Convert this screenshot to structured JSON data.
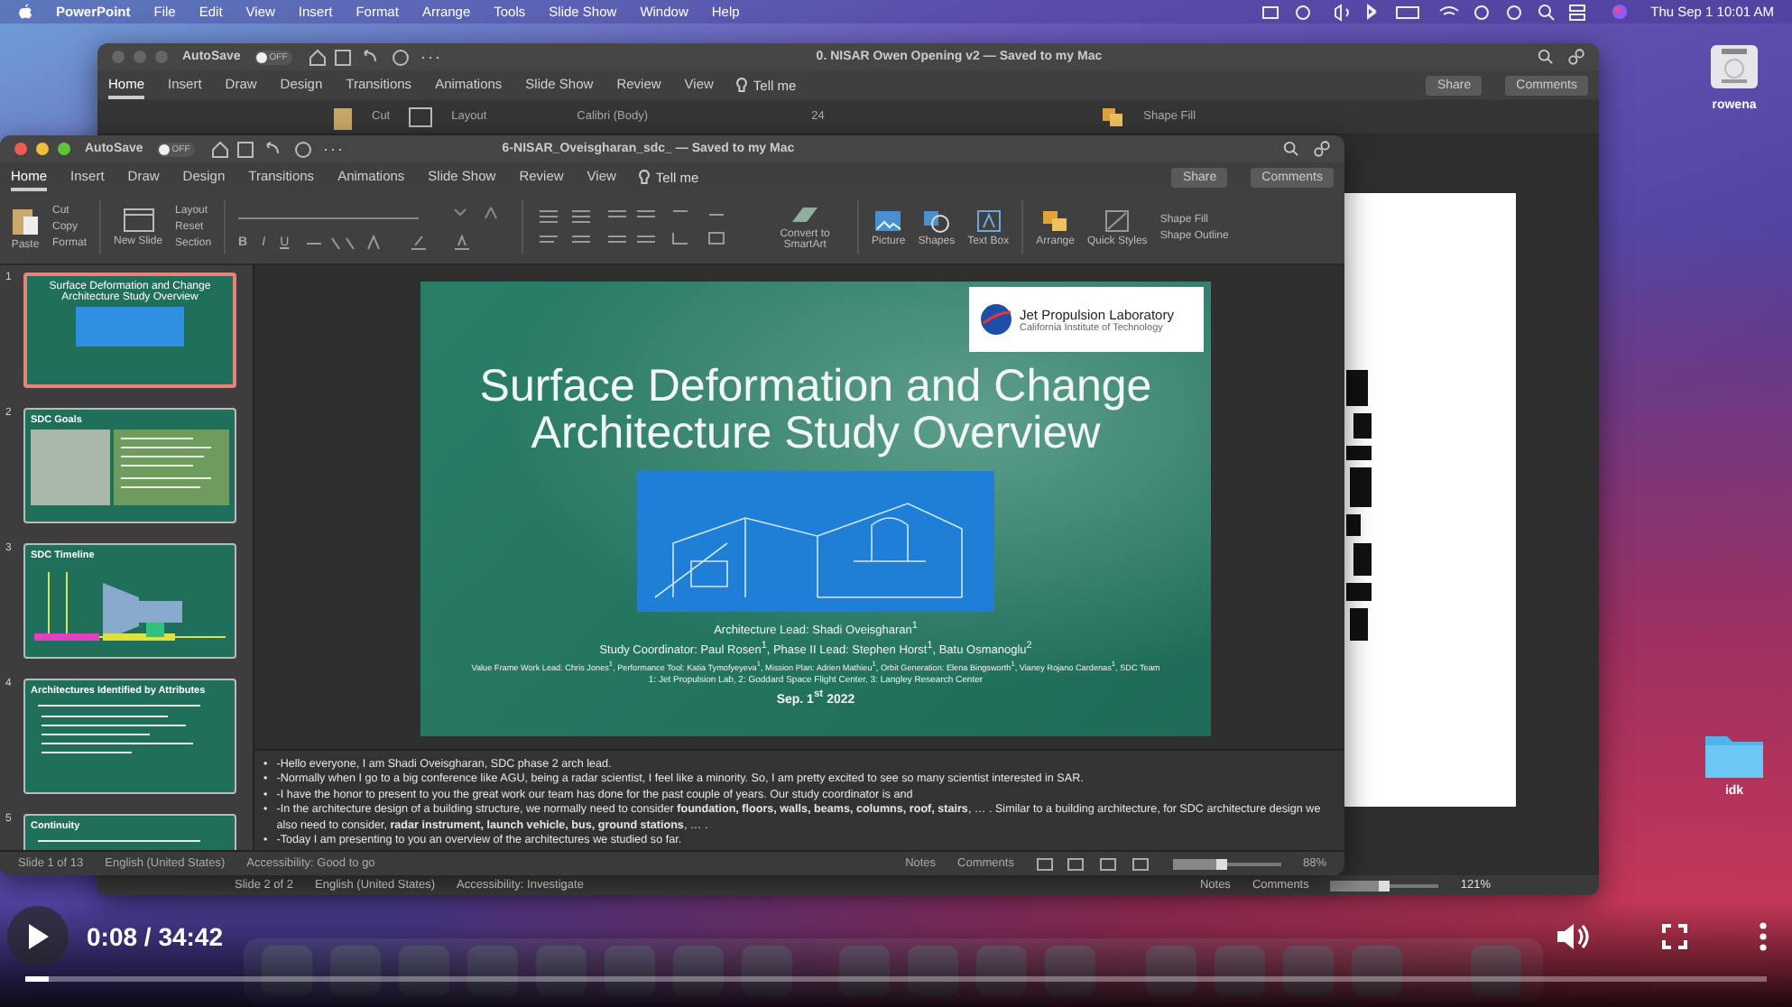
{
  "menubar": {
    "app": "PowerPoint",
    "items": [
      "File",
      "Edit",
      "View",
      "Insert",
      "Format",
      "Arrange",
      "Tools",
      "Slide Show",
      "Window",
      "Help"
    ],
    "clock": "Thu Sep 1  10:01 AM"
  },
  "back_window": {
    "autosave": {
      "label": "AutoSave",
      "on": false,
      "state_text": "OFF"
    },
    "title": "0. NISAR Owen Opening v2 — Saved to my Mac",
    "tabs": [
      {
        "label": "Home",
        "selected": true
      },
      {
        "label": "Insert",
        "selected": false
      },
      {
        "label": "Draw",
        "selected": false
      },
      {
        "label": "Design",
        "selected": false
      },
      {
        "label": "Transitions",
        "selected": false
      },
      {
        "label": "Animations",
        "selected": false
      },
      {
        "label": "Slide Show",
        "selected": false
      },
      {
        "label": "Review",
        "selected": false
      },
      {
        "label": "View",
        "selected": false
      }
    ],
    "tell_me": "Tell me",
    "share": "Share",
    "comments": "Comments",
    "ribbon": {
      "cut": "Cut",
      "layout": "Layout",
      "font": "Calibri (Body)",
      "size": "24",
      "shape_fill": "Shape Fill"
    },
    "status": {
      "slide": "Slide 2 of 2",
      "language": "English (United States)",
      "accessibility": "Accessibility: Investigate",
      "notes": "Notes",
      "comments": "Comments",
      "zoom": "121%",
      "zoom_slider": {
        "level": 0.55
      }
    }
  },
  "front_window": {
    "autosave": {
      "label": "AutoSave",
      "on": false,
      "state_text": "OFF"
    },
    "title": "6-NISAR_Oveisgharan_sdc_ — Saved to my Mac",
    "tabs": [
      {
        "label": "Home",
        "selected": true
      },
      {
        "label": "Insert",
        "selected": false
      },
      {
        "label": "Draw",
        "selected": false
      },
      {
        "label": "Design",
        "selected": false
      },
      {
        "label": "Transitions",
        "selected": false
      },
      {
        "label": "Animations",
        "selected": false
      },
      {
        "label": "Slide Show",
        "selected": false
      },
      {
        "label": "Review",
        "selected": false
      },
      {
        "label": "View",
        "selected": false
      }
    ],
    "tell_me": "Tell me",
    "share": "Share",
    "comments": "Comments",
    "ribbon": {
      "paste": "Paste",
      "cut": "Cut",
      "copy": "Copy",
      "format": "Format",
      "new_slide": "New Slide",
      "layout": "Layout",
      "reset": "Reset",
      "section": "Section",
      "format_buttons": [
        "B",
        "I",
        "U"
      ],
      "smartart": "Convert to SmartArt",
      "picture": "Picture",
      "shapes": "Shapes",
      "text_box": "Text Box",
      "arrange": "Arrange",
      "quick_styles": "Quick Styles",
      "shape_fill": "Shape Fill",
      "shape_outline": "Shape Outline"
    },
    "thumbnails": [
      {
        "number": "1",
        "title": "Surface Deformation and Change Architecture Study Overview",
        "kind": "title",
        "selected": true
      },
      {
        "number": "2",
        "title": "SDC Goals",
        "kind": "photos",
        "selected": false
      },
      {
        "number": "3",
        "title": "SDC Timeline",
        "kind": "timeline",
        "selected": false
      },
      {
        "number": "4",
        "title": "Architectures Identified by Attributes",
        "kind": "list",
        "selected": false
      },
      {
        "number": "5",
        "title": "Continuity",
        "kind": "list",
        "selected": false
      }
    ],
    "slide": {
      "logo_title": "Jet Propulsion Laboratory",
      "logo_subtitle": "California Institute of Technology",
      "title": "Surface Deformation and Change Architecture Study Overview",
      "credits": [
        "Architecture Lead: Shadi Oveisgharan$^{1}$",
        "Study Coordinator: Paul Rosen$^{1}$, Phase II Lead: Stephen Horst$^{1}$, Batu Osmanoglu$^{2}$",
        "Value Frame Work Lead: Chris Jones$^{1}$, Performance Tool: Katia Tymofyeyeva$^{1}$, Mission Plan: Adrien Mathieu$^{1}$, Orbit Generation: Elena Bingsworth$^{1}$, Vianey Rojano Cardenas$^{1}$, SDC Team",
        "1: Jet Propulsion Lab, 2: Goddard Space Flight Center, 3: Langley Research Center"
      ],
      "date": "Sep. 1$^{st}$ 2022"
    },
    "notes": [
      {
        "bullet": "•",
        "text": "-Hello everyone, I am Shadi Oveisgharan, SDC phase 2 arch lead."
      },
      {
        "bullet": "•",
        "text": "-Normally when I go to a big conference like AGU, being a radar scientist, I feel like a minority. So, I am pretty excited to see so many scientist interested in SAR."
      },
      {
        "bullet": "•",
        "text": "-I have the honor to present to you the great work our team has done for the past couple of years. Our study coordinator is and"
      },
      {
        "bullet": "•",
        "text": "-In the architecture design of a building structure, we normally need to consider **foundation, floors, walls, beams, columns, roof, stairs**, … . Similar to a building architecture, for SDC architecture design we also need to consider, **radar instrument, launch vehicle, bus, ground stations**, … ."
      },
      {
        "bullet": "•",
        "text": "-Today I am presenting to you an overview of the architectures we studied so far."
      }
    ],
    "status": {
      "slide": "Slide 1 of 13",
      "language": "English (United States)",
      "accessibility": "Accessibility: Good to go",
      "notes": "Notes",
      "comments": "Comments",
      "zoom": "88%",
      "zoom_slider": {
        "level": 0.5
      }
    }
  },
  "desktop_icons": [
    {
      "label": "rowena",
      "kind": "drive"
    },
    {
      "label": "idk",
      "kind": "folder"
    }
  ],
  "video_player": {
    "playing": false,
    "time": "0:08 / 34:42",
    "progress": {
      "level": 0.013
    }
  }
}
